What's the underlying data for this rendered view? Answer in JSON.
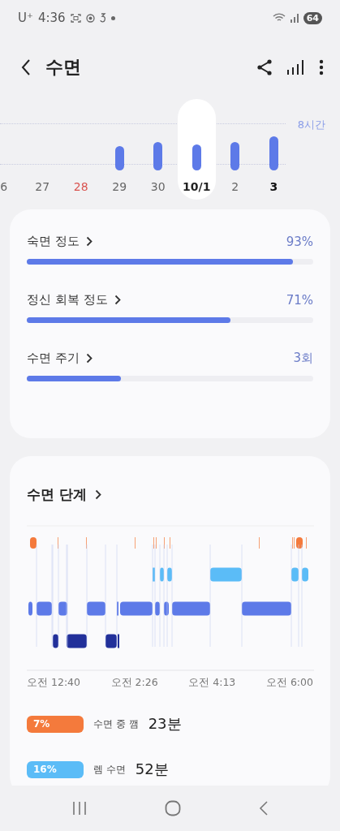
{
  "status_bar": {
    "carrier": "U⁺",
    "time": "4:36",
    "battery": "64"
  },
  "header": {
    "title": "수면"
  },
  "week_chart": {
    "goal_label": "8시간",
    "days": [
      {
        "label": "6",
        "kind": "normal",
        "selected": false
      },
      {
        "label": "27",
        "kind": "normal",
        "selected": false
      },
      {
        "label": "28",
        "kind": "holiday",
        "selected": false
      },
      {
        "label": "29",
        "kind": "normal",
        "selected": false
      },
      {
        "label": "30",
        "kind": "normal",
        "selected": false
      },
      {
        "label": "10/1",
        "kind": "normal",
        "selected": true
      },
      {
        "label": "2",
        "kind": "normal",
        "selected": false
      },
      {
        "label": "3",
        "kind": "today",
        "selected": false
      }
    ]
  },
  "scores": [
    {
      "label": "숙면 정도",
      "value": "93%",
      "level": 0.93
    },
    {
      "label": "정신 회복 정도",
      "value": "71%",
      "level": 0.71
    },
    {
      "label": "수면 주기",
      "value": "3회",
      "level": 0.33
    }
  ],
  "stages": {
    "title": "수면 단계",
    "time_labels": [
      "오전 12:40",
      "오전 2:26",
      "오전 4:13",
      "오전 6:00"
    ],
    "legend": [
      {
        "percent": "7%",
        "label": "수면 중 깸",
        "value": "23분",
        "color": "#f47a3c"
      },
      {
        "percent": "16%",
        "label": "렘 수면",
        "value": "52분",
        "color": "#5bbcf7"
      }
    ]
  }
}
